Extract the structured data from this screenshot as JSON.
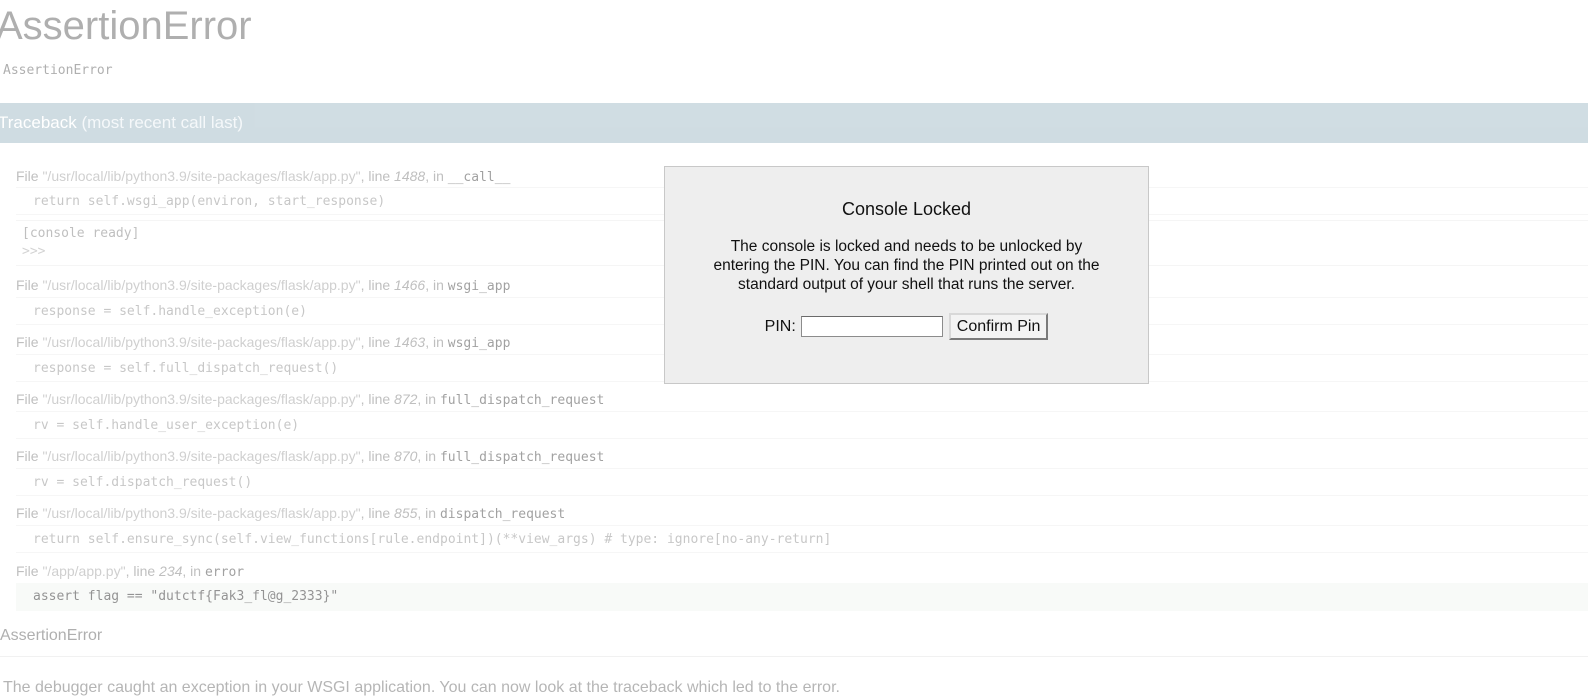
{
  "page": {
    "error_title": "AssertionError",
    "error_subtitle": "AssertionError",
    "traceback_header": "Traceback",
    "traceback_hint": "(most recent call last)",
    "final_error": "AssertionError",
    "explanation": "The debugger caught an exception in your WSGI application. You can now look at the traceback which led to the error."
  },
  "frames": [
    {
      "file_prefix": "File ",
      "path": "\"/usr/local/lib/python3.9/site-packages/flask/app.py\"",
      "line_word": ", line ",
      "line": "1488",
      "in_word": ", in ",
      "function": "__call__",
      "code": "return self.wsgi_app(environ, start_response)"
    },
    {
      "file_prefix": "File ",
      "path": "\"/usr/local/lib/python3.9/site-packages/flask/app.py\"",
      "line_word": ", line ",
      "line": "1466",
      "in_word": ", in ",
      "function": "wsgi_app",
      "code": "response = self.handle_exception(e)"
    },
    {
      "file_prefix": "File ",
      "path": "\"/usr/local/lib/python3.9/site-packages/flask/app.py\"",
      "line_word": ", line ",
      "line": "1463",
      "in_word": ", in ",
      "function": "wsgi_app",
      "code": "response = self.full_dispatch_request()"
    },
    {
      "file_prefix": "File ",
      "path": "\"/usr/local/lib/python3.9/site-packages/flask/app.py\"",
      "line_word": ", line ",
      "line": "872",
      "in_word": ", in ",
      "function": "full_dispatch_request",
      "code": "rv = self.handle_user_exception(e)"
    },
    {
      "file_prefix": "File ",
      "path": "\"/usr/local/lib/python3.9/site-packages/flask/app.py\"",
      "line_word": ", line ",
      "line": "870",
      "in_word": ", in ",
      "function": "full_dispatch_request",
      "code": "rv = self.dispatch_request()"
    },
    {
      "file_prefix": "File ",
      "path": "\"/usr/local/lib/python3.9/site-packages/flask/app.py\"",
      "line_word": ", line ",
      "line": "855",
      "in_word": ", in ",
      "function": "dispatch_request",
      "code": "return self.ensure_sync(self.view_functions[rule.endpoint])(**view_args)  # type: ignore[no-any-return]"
    },
    {
      "file_prefix": "File ",
      "path": "\"/app/app.py\"",
      "line_word": ", line ",
      "line": "234",
      "in_word": ", in ",
      "function": "error",
      "code": "assert flag == \"dutctf{Fak3_fl@g_2333}\""
    }
  ],
  "console": {
    "status": "[console ready]",
    "prompt": ">>>"
  },
  "modal": {
    "title": "Console Locked",
    "text": "The console is locked and needs to be unlocked by entering the PIN. You can find the PIN printed out on the standard output of your shell that runs the server.",
    "pin_label": "PIN:",
    "pin_value": "",
    "confirm_label": "Confirm Pin"
  },
  "colors": {
    "traceback_header_bg": "#a9c1cc",
    "modal_bg": "#eeeeee"
  }
}
